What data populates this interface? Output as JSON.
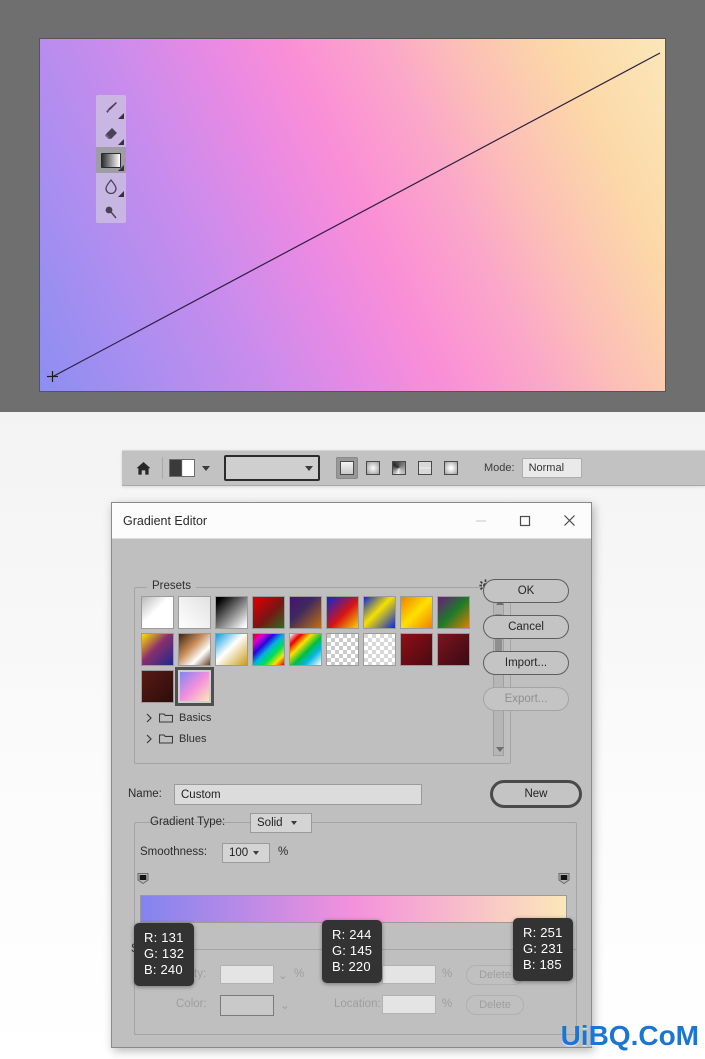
{
  "canvas": {
    "gradient_css": "linear-gradient(65deg,#8d8ef2 0%,#a98ef0 14%,#c78ced 28%,#e98ae3 42%,#fb8fd6 52%,#fba7c9 64%,#fcc0b6 74%,#fcd8a8 86%,#fbe7b9 100%)",
    "tools": [
      {
        "name": "brush-tool",
        "label": "Brush Tool",
        "selected": false
      },
      {
        "name": "eraser-tool",
        "label": "Eraser Tool",
        "selected": false
      },
      {
        "name": "gradient-tool",
        "label": "Gradient Tool",
        "selected": true
      },
      {
        "name": "blur-tool",
        "label": "Blur Tool",
        "selected": false
      },
      {
        "name": "dodge-tool",
        "label": "Dodge Tool",
        "selected": false
      }
    ]
  },
  "options_bar": {
    "home_icon": "home-icon",
    "preset_picker_label": "gradient-preset-picker",
    "gradient_swatch_label": "gradient-swatch",
    "gradient_types": [
      {
        "name": "linear-gradient-button",
        "label": "Linear Gradient",
        "selected": true
      },
      {
        "name": "radial-gradient-button",
        "label": "Radial Gradient",
        "selected": false
      },
      {
        "name": "angle-gradient-button",
        "label": "Angle Gradient",
        "selected": false
      },
      {
        "name": "reflected-gradient-button",
        "label": "Reflected Gradient",
        "selected": false
      },
      {
        "name": "diamond-gradient-button",
        "label": "Diamond Gradient",
        "selected": false
      }
    ],
    "mode_label": "Mode:",
    "mode_value": "Normal"
  },
  "dialog": {
    "title": "Gradient Editor",
    "window_buttons": {
      "minimize": "minimize-icon",
      "maximize": "maximize-icon",
      "close": "close-icon"
    },
    "presets": {
      "legend": "Presets",
      "gear_icon": "gear-icon",
      "folders": [
        {
          "label": "Basics"
        },
        {
          "label": "Blues"
        }
      ],
      "swatch_count": 20,
      "selected_index": 19
    },
    "buttons": {
      "ok": "OK",
      "cancel": "Cancel",
      "import": "Import...",
      "export": "Export...",
      "new": "New"
    },
    "name": {
      "label": "Name:",
      "value": "Custom"
    },
    "gradient_type": {
      "label": "Gradient Type:",
      "value": "Solid"
    },
    "smoothness": {
      "label": "Smoothness:",
      "value": "100",
      "unit": "%"
    },
    "ramp": {
      "gradient_css": "linear-gradient(90deg,#8384f0 0%,#f491dc 50%,#fbe7b9 100%)",
      "opacity_stops": [
        {
          "position_pct": 0,
          "opacity": 100
        },
        {
          "position_pct": 100,
          "opacity": 100
        }
      ],
      "color_stops": [
        {
          "position_pct": 0,
          "color": "#8384f0"
        },
        {
          "position_pct": 50,
          "color": "#f491dc"
        },
        {
          "position_pct": 100,
          "color": "#fbe7b9"
        }
      ]
    },
    "stops": {
      "legend": "Stops",
      "opacity_label": "Opacity:",
      "opacity_value": "",
      "opacity_unit": "%",
      "location_label": "Location:",
      "location_value": "",
      "location_unit": "%",
      "color_label": "Color:",
      "delete_top": "Delete",
      "delete_bottom": "Delete"
    }
  },
  "tooltips": [
    {
      "name": "rgb-tooltip-left",
      "r": "R: 131",
      "g": "G: 132",
      "b": "B: 240",
      "hex": "#8384f0"
    },
    {
      "name": "rgb-tooltip-middle",
      "r": "R: 244",
      "g": "G: 145",
      "b": "B: 220",
      "hex": "#f491dc"
    },
    {
      "name": "rgb-tooltip-right",
      "r": "R: 251",
      "g": "G: 231",
      "b": "B: 185",
      "hex": "#fbe7b9"
    }
  ],
  "watermark": {
    "text": "UiBQ.CoM",
    "color": "#1b76d2"
  }
}
